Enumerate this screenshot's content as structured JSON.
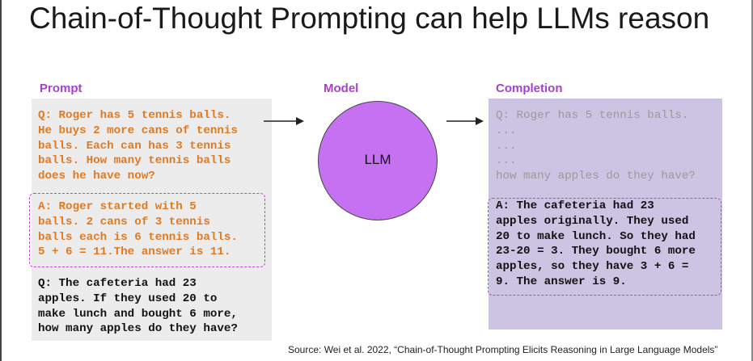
{
  "title": "Chain-of-Thought Prompting can help LLMs reason",
  "labels": {
    "prompt": "Prompt",
    "model": "Model",
    "completion": "Completion"
  },
  "prompt": {
    "example_question": "Q: Roger has 5 tennis balls.\nHe buys 2 more cans of tennis\nballs. Each can has 3 tennis\nballs. How many tennis balls\ndoes he have now?",
    "example_answer": "A: Roger started with 5\nballs. 2 cans of 3 tennis\nballs each is 6 tennis balls.\n5 + 6 = 11.The answer is 11.",
    "new_question": "Q: The cafeteria had 23\napples. If they used 20 to\nmake lunch and bought 6 more,\nhow many apples do they have?"
  },
  "model": {
    "name": "LLM"
  },
  "completion": {
    "echo_prompt": "Q: Roger has 5 tennis balls.\n...\n...\n...\nhow many apples do they have?",
    "answer": "A: The cafeteria had 23\napples originally. They used\n20 to make lunch. So they had\n23-20 = 3. They bought 6 more\napples, so they have 3 + 6 =\n9. The answer is 9."
  },
  "source": "Source: Wei et al. 2022, “Chain-of-Thought Prompting Elicits Reasoning in Large Language Models”",
  "colors": {
    "accent_purple": "#a73fd1",
    "orange_text": "#e07a22",
    "llm_fill": "#c571f2",
    "prompt_bg": "#ececec",
    "completion_bg": "#cdc3e2",
    "dashed_border": "#c53fd6"
  }
}
